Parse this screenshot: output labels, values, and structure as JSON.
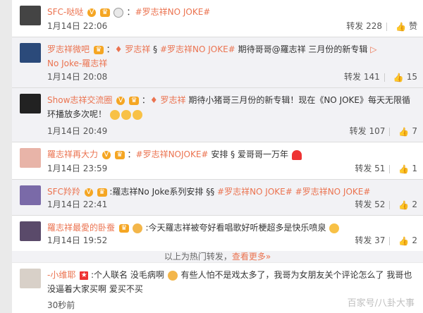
{
  "comments": [
    {
      "user": "SFC-哒哒",
      "content": "#罗志祥NO JOKE#",
      "time": "1月14日 22:06",
      "repost": "转发 228",
      "like": "赞"
    },
    {
      "user": "罗志祥微吧",
      "repost_prefix": "罗志祥",
      "content": "#罗志祥NO JOKE#",
      "tail": "期待哥哥@羅志祥 三月份的新专辑",
      "tail2": "No Joke-羅志祥",
      "time": "1月14日 20:08",
      "repost": "转发 141",
      "like": "15"
    },
    {
      "user": "Show志祥交流圈",
      "repost_prefix": "罗志祥",
      "content": "期待小猪哥三月份的新专辑！现在《NO JOKE》每天无限循",
      "content2": "环播放多次呢！",
      "time": "1月14日 20:49",
      "repost": "转发 107",
      "like": "7"
    },
    {
      "user": "羅志祥再大力",
      "content": "#罗志祥NOJOKE#",
      "tail": "安排",
      "tail2": "爱哥哥一万年",
      "time": "1月14日 23:59",
      "repost": "转发 51",
      "like": "1"
    },
    {
      "user": "SFC羚羚",
      "prefix": ":羅志祥No Joke系列安排",
      "content": "#罗志祥NO JOKE#",
      "content_b": "#罗志祥NO JOKE#",
      "time": "1月14日 22:41",
      "repost": "转发 52",
      "like": "2"
    },
    {
      "user": "羅志祥最愛的卧蚕",
      "content": ":今天羅志祥被夸好看唱歌好听梗超多是快乐喷泉",
      "time": "1月14日 19:52",
      "repost": "转发 37",
      "like": "2"
    },
    {
      "user": "-小维耶",
      "content": ":个人联名 没毛病啊",
      "tail": "有些人怕不是戏太多了，我哥为女朋友关个评论怎么了 我哥也",
      "content2": "没逼着大家买啊 爱买不买",
      "time": "30秒前"
    }
  ],
  "footer_note": {
    "prefix": "以上为热门转发，",
    "more": "查看更多»"
  },
  "watermark": "百家号/八卦大事"
}
